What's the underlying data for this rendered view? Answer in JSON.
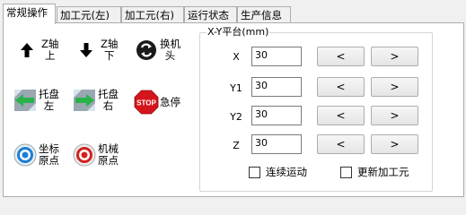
{
  "tabs": [
    "常规操作",
    "加工元(左)",
    "加工元(右)",
    "运行状态",
    "生产信息"
  ],
  "left_buttons": {
    "z_up": [
      "Z轴",
      "上"
    ],
    "z_down": [
      "Z轴",
      "下"
    ],
    "change_head": [
      "换机",
      "头"
    ],
    "tray_left": [
      "托盘",
      "左"
    ],
    "tray_right": [
      "托盘",
      "右"
    ],
    "estop_icon_text": "STOP",
    "estop_label": "急停",
    "coord_origin": [
      "坐标",
      "原点"
    ],
    "machine_origin": [
      "机械",
      "原点"
    ]
  },
  "xy_group": {
    "title": "X-Y平台(mm)",
    "rows": [
      {
        "label": "X",
        "value": "30",
        "minus": "<",
        "plus": ">"
      },
      {
        "label": "Y1",
        "value": "30",
        "minus": "<",
        "plus": ">"
      },
      {
        "label": "Y2",
        "value": "30",
        "minus": "<",
        "plus": ">"
      },
      {
        "label": "Z",
        "value": "30",
        "minus": "<",
        "plus": ">"
      }
    ],
    "continuous_label": "连续运动",
    "update_label": "更新加工元"
  }
}
